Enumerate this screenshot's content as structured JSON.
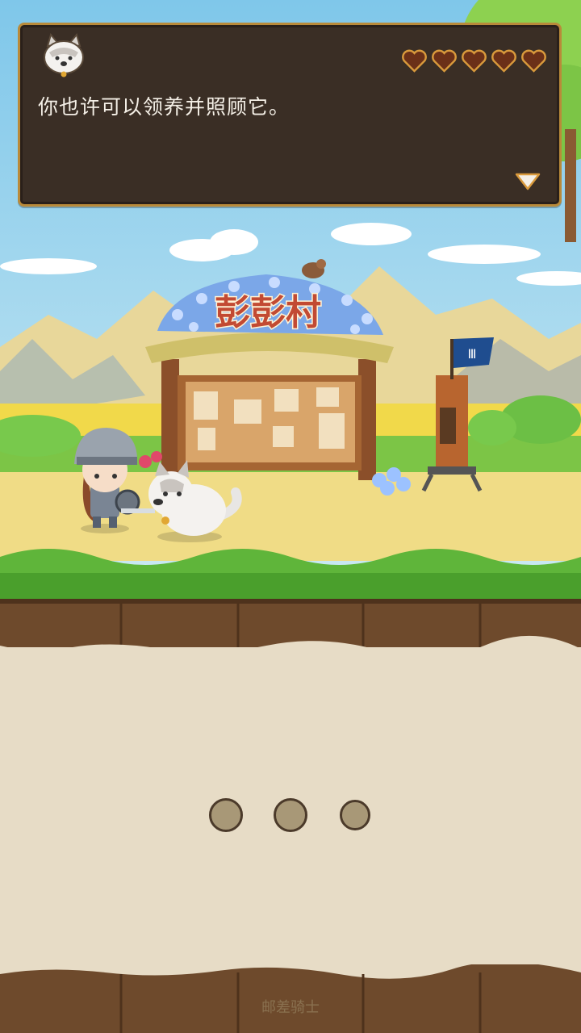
{
  "dialog": {
    "speaker_icon": "husky-portrait-icon",
    "hearts": {
      "filled": 5,
      "total": 5
    },
    "text": "你也许可以领养并照顾它。",
    "next_icon": "triangle-down-icon"
  },
  "scene": {
    "sign_title": "彭彭村",
    "flag_icon": "shield-banner-icon",
    "characters": [
      "knight-character",
      "husky-dog-character",
      "sparrow-bird"
    ]
  },
  "loading_dots": {
    "count": 3
  },
  "footer": {
    "app_name": "邮差骑士"
  },
  "colors": {
    "dialog_bg": "#3a2e25",
    "dialog_border": "#b98a3a",
    "heart": "#6b3018",
    "panel_bg": "#e7dcc6",
    "soil": "#6e4a2c",
    "grass": "#5fb53a",
    "sign_text": "#c24a33"
  }
}
